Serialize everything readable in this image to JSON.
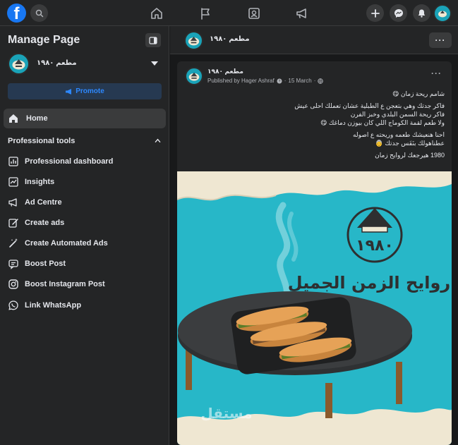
{
  "topbar": {
    "logo_letter": "f",
    "nav_icons": [
      "home-icon",
      "flag-icon",
      "insights-icon",
      "megaphone-icon"
    ],
    "right_icons": [
      "plus-icon",
      "messenger-icon",
      "bell-icon",
      "profile-avatar"
    ]
  },
  "sidebar": {
    "title": "Manage Page",
    "page_name": "مطعم ١٩٨٠",
    "promote_label": "Promote",
    "home_label": "Home",
    "section_title": "Professional tools",
    "tools": [
      {
        "label": "Professional dashboard",
        "icon": "dashboard-icon"
      },
      {
        "label": "Insights",
        "icon": "insights-icon"
      },
      {
        "label": "Ad Centre",
        "icon": "megaphone-icon"
      },
      {
        "label": "Create ads",
        "icon": "pencil-icon"
      },
      {
        "label": "Create Automated Ads",
        "icon": "magic-wand-icon"
      },
      {
        "label": "Boost Post",
        "icon": "chat-bubble-icon"
      },
      {
        "label": "Boost Instagram Post",
        "icon": "instagram-icon"
      },
      {
        "label": "Link WhatsApp",
        "icon": "whatsapp-icon"
      }
    ]
  },
  "main": {
    "header_name": "مطعم ١٩٨٠",
    "more_label": "···",
    "post": {
      "author": "مطعم ١٩٨٠",
      "published_by": "Published by Hager Ashraf",
      "date": "15 March",
      "more_label": "···",
      "lines": [
        "شامم ريحة زمان 😋",
        "",
        "فاكر جدتك وهي بتعجن ع الطبلية عشان تعملك احلى عيش",
        "فاكر ريحة السمن البلدي وخبز الفرن",
        "ولا طعم لقمة الكوماج اللي كان بيوزن دماغك 😋",
        "",
        "احنا هنعيشك طعمه وريحته ع اصوله",
        "عطناهولك بنَفَس جدتك 👵",
        "",
        "1980 هيرجعك لروايح زمان"
      ],
      "image": {
        "logo_text": "١٩٨٠",
        "tagline": "روايح الزمن الجميل",
        "watermark": "مستقل",
        "colors": {
          "background": "#27b7c8",
          "paper": "#efe7d2",
          "table": "#3b3d3f"
        }
      }
    }
  },
  "colors": {
    "accent": "#1877f2",
    "promote_text": "#2d88ff",
    "promote_bg": "#263951",
    "surface": "#242526",
    "page_bg": "#18191a"
  }
}
